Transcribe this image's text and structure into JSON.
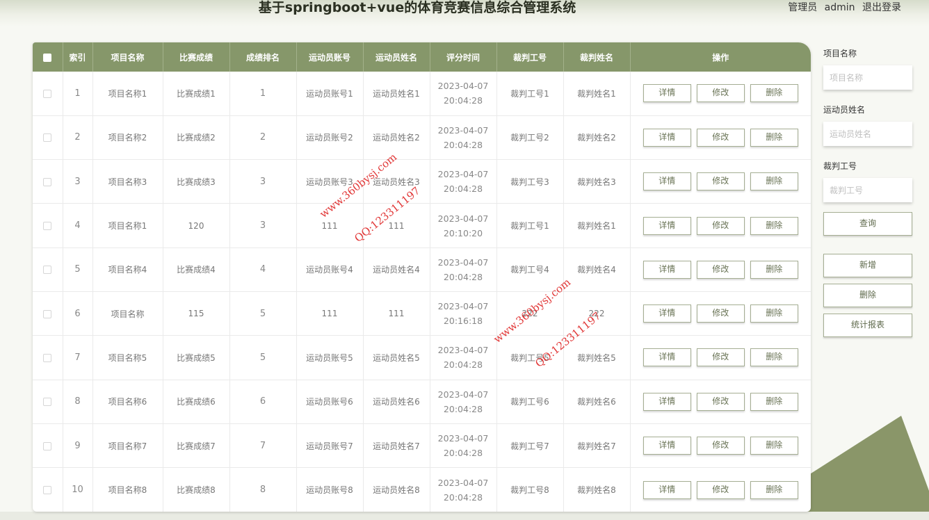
{
  "header": {
    "title": "基于springboot+vue的体育竞赛信息综合管理系统",
    "role": "管理员",
    "username": "admin",
    "logout": "退出登录"
  },
  "table": {
    "columns": [
      "索引",
      "项目名称",
      "比赛成绩",
      "成绩排名",
      "运动员账号",
      "运动员姓名",
      "评分时间",
      "裁判工号",
      "裁判姓名",
      "操作"
    ],
    "actions": {
      "detail": "详情",
      "edit": "修改",
      "delete": "删除"
    },
    "rows": [
      {
        "index": "1",
        "project": "项目名称1",
        "score": "比赛成绩1",
        "rank": "1",
        "athlete_account": "运动员账号1",
        "athlete_name": "运动员姓名1",
        "date": "2023-04-07",
        "time": "20:04:28",
        "judge_id": "裁判工号1",
        "judge_name": "裁判姓名1"
      },
      {
        "index": "2",
        "project": "项目名称2",
        "score": "比赛成绩2",
        "rank": "2",
        "athlete_account": "运动员账号2",
        "athlete_name": "运动员姓名2",
        "date": "2023-04-07",
        "time": "20:04:28",
        "judge_id": "裁判工号2",
        "judge_name": "裁判姓名2"
      },
      {
        "index": "3",
        "project": "项目名称3",
        "score": "比赛成绩3",
        "rank": "3",
        "athlete_account": "运动员账号3",
        "athlete_name": "运动员姓名3",
        "date": "2023-04-07",
        "time": "20:04:28",
        "judge_id": "裁判工号3",
        "judge_name": "裁判姓名3"
      },
      {
        "index": "4",
        "project": "项目名称1",
        "score": "120",
        "rank": "3",
        "athlete_account": "111",
        "athlete_name": "111",
        "date": "2023-04-07",
        "time": "20:10:20",
        "judge_id": "裁判工号1",
        "judge_name": "裁判姓名1"
      },
      {
        "index": "5",
        "project": "项目名称4",
        "score": "比赛成绩4",
        "rank": "4",
        "athlete_account": "运动员账号4",
        "athlete_name": "运动员姓名4",
        "date": "2023-04-07",
        "time": "20:04:28",
        "judge_id": "裁判工号4",
        "judge_name": "裁判姓名4"
      },
      {
        "index": "6",
        "project": "项目名称",
        "score": "115",
        "rank": "5",
        "athlete_account": "111",
        "athlete_name": "111",
        "date": "2023-04-07",
        "time": "20:16:18",
        "judge_id": "222",
        "judge_name": "222"
      },
      {
        "index": "7",
        "project": "项目名称5",
        "score": "比赛成绩5",
        "rank": "5",
        "athlete_account": "运动员账号5",
        "athlete_name": "运动员姓名5",
        "date": "2023-04-07",
        "time": "20:04:28",
        "judge_id": "裁判工号5",
        "judge_name": "裁判姓名5"
      },
      {
        "index": "8",
        "project": "项目名称6",
        "score": "比赛成绩6",
        "rank": "6",
        "athlete_account": "运动员账号6",
        "athlete_name": "运动员姓名6",
        "date": "2023-04-07",
        "time": "20:04:28",
        "judge_id": "裁判工号6",
        "judge_name": "裁判姓名6"
      },
      {
        "index": "9",
        "project": "项目名称7",
        "score": "比赛成绩7",
        "rank": "7",
        "athlete_account": "运动员账号7",
        "athlete_name": "运动员姓名7",
        "date": "2023-04-07",
        "time": "20:04:28",
        "judge_id": "裁判工号7",
        "judge_name": "裁判姓名7"
      },
      {
        "index": "10",
        "project": "项目名称8",
        "score": "比赛成绩8",
        "rank": "8",
        "athlete_account": "运动员账号8",
        "athlete_name": "运动员姓名8",
        "date": "2023-04-07",
        "time": "20:04:28",
        "judge_id": "裁判工号8",
        "judge_name": "裁判姓名8"
      }
    ]
  },
  "search": {
    "project_label": "项目名称",
    "project_placeholder": "项目名称",
    "project_value": "",
    "athlete_label": "运动员姓名",
    "athlete_placeholder": "运动员姓名",
    "athlete_value": "",
    "judge_label": "裁判工号",
    "judge_placeholder": "裁判工号",
    "judge_value": "",
    "query": "查询",
    "add": "新增",
    "delete": "删除",
    "report": "统计报表"
  },
  "watermarks": {
    "site": "www.360bysj.com",
    "qq": "QQ:123311197"
  },
  "colors": {
    "accent": "#86976a",
    "deco": "#8a9669",
    "watermark": "#dc1414"
  },
  "icons": {
    "select_all": "checkbox-icon",
    "row_select": "checkbox-icon"
  }
}
